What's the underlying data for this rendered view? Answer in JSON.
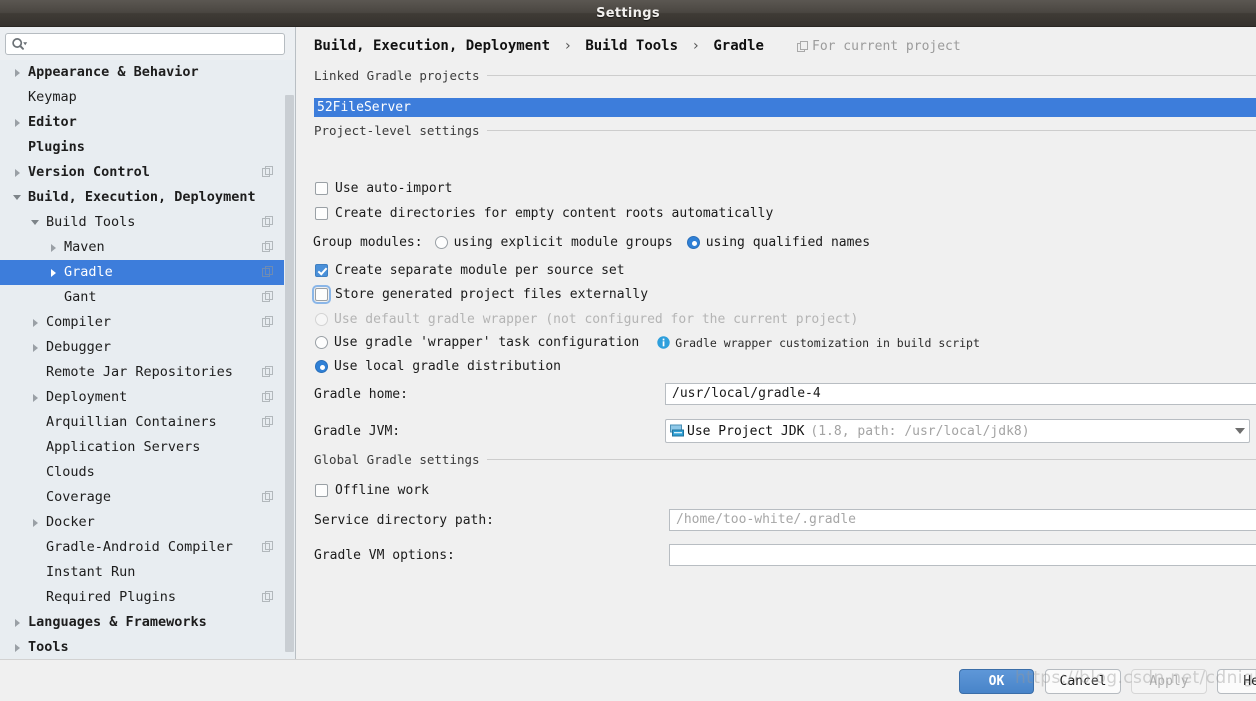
{
  "window": {
    "title": "Settings"
  },
  "search": {
    "value": "",
    "placeholder": "",
    "icon": "search-icon"
  },
  "sidebar": {
    "items": [
      {
        "label": "Appearance & Behavior",
        "indent": 0,
        "arrow": "closed",
        "bold": true,
        "badge": false,
        "selected": false
      },
      {
        "label": "Keymap",
        "indent": 0,
        "arrow": "none",
        "bold": false,
        "badge": false,
        "selected": false
      },
      {
        "label": "Editor",
        "indent": 0,
        "arrow": "closed",
        "bold": true,
        "badge": false,
        "selected": false
      },
      {
        "label": "Plugins",
        "indent": 0,
        "arrow": "none",
        "bold": true,
        "badge": false,
        "selected": false
      },
      {
        "label": "Version Control",
        "indent": 0,
        "arrow": "closed",
        "bold": true,
        "badge": true,
        "selected": false
      },
      {
        "label": "Build, Execution, Deployment",
        "indent": 0,
        "arrow": "open",
        "bold": true,
        "badge": false,
        "selected": false
      },
      {
        "label": "Build Tools",
        "indent": 1,
        "arrow": "open",
        "bold": false,
        "badge": true,
        "selected": false
      },
      {
        "label": "Maven",
        "indent": 2,
        "arrow": "closed",
        "bold": false,
        "badge": true,
        "selected": false
      },
      {
        "label": "Gradle",
        "indent": 2,
        "arrow": "closed",
        "bold": false,
        "badge": true,
        "selected": true
      },
      {
        "label": "Gant",
        "indent": 2,
        "arrow": "none",
        "bold": false,
        "badge": true,
        "selected": false
      },
      {
        "label": "Compiler",
        "indent": 1,
        "arrow": "closed",
        "bold": false,
        "badge": true,
        "selected": false
      },
      {
        "label": "Debugger",
        "indent": 1,
        "arrow": "closed",
        "bold": false,
        "badge": false,
        "selected": false
      },
      {
        "label": "Remote Jar Repositories",
        "indent": 1,
        "arrow": "none",
        "bold": false,
        "badge": true,
        "selected": false
      },
      {
        "label": "Deployment",
        "indent": 1,
        "arrow": "closed",
        "bold": false,
        "badge": true,
        "selected": false
      },
      {
        "label": "Arquillian Containers",
        "indent": 1,
        "arrow": "none",
        "bold": false,
        "badge": true,
        "selected": false
      },
      {
        "label": "Application Servers",
        "indent": 1,
        "arrow": "none",
        "bold": false,
        "badge": false,
        "selected": false
      },
      {
        "label": "Clouds",
        "indent": 1,
        "arrow": "none",
        "bold": false,
        "badge": false,
        "selected": false
      },
      {
        "label": "Coverage",
        "indent": 1,
        "arrow": "none",
        "bold": false,
        "badge": true,
        "selected": false
      },
      {
        "label": "Docker",
        "indent": 1,
        "arrow": "closed",
        "bold": false,
        "badge": false,
        "selected": false
      },
      {
        "label": "Gradle-Android Compiler",
        "indent": 1,
        "arrow": "none",
        "bold": false,
        "badge": true,
        "selected": false
      },
      {
        "label": "Instant Run",
        "indent": 1,
        "arrow": "none",
        "bold": false,
        "badge": false,
        "selected": false
      },
      {
        "label": "Required Plugins",
        "indent": 1,
        "arrow": "none",
        "bold": false,
        "badge": true,
        "selected": false
      },
      {
        "label": "Languages & Frameworks",
        "indent": 0,
        "arrow": "closed",
        "bold": true,
        "badge": false,
        "selected": false
      },
      {
        "label": "Tools",
        "indent": 0,
        "arrow": "closed",
        "bold": true,
        "badge": false,
        "selected": false
      }
    ]
  },
  "main": {
    "breadcrumb": [
      "Build, Execution, Deployment",
      "Build Tools",
      "Gradle"
    ],
    "breadcrumb_separator": "›",
    "for_current_project": "For current project",
    "groups": {
      "linked": "Linked Gradle projects",
      "project_level": "Project-level settings",
      "global": "Global Gradle settings"
    },
    "linked_project": "52FileServer",
    "options": {
      "use_auto_import": {
        "label": "Use auto-import",
        "checked": false
      },
      "create_directories": {
        "label": "Create directories for empty content roots automatically",
        "checked": false
      },
      "group_modules_label": "Group modules:",
      "group_explicit": {
        "label": "using explicit module groups",
        "checked": false
      },
      "group_qualified": {
        "label": "using qualified names",
        "checked": true
      },
      "separate_module": {
        "label": "Create separate module per source set",
        "checked": true
      },
      "store_externally": {
        "label": "Store generated project files externally",
        "checked": false,
        "focused": true
      },
      "default_wrapper": {
        "label": "Use default gradle wrapper (not configured for the current project)",
        "checked": false,
        "disabled": true
      },
      "wrapper_task": {
        "label": "Use gradle 'wrapper' task configuration",
        "checked": false
      },
      "wrapper_hint": "Gradle wrapper customization in build script",
      "local_distribution": {
        "label": "Use local gradle distribution",
        "checked": true
      },
      "offline_work": {
        "label": "Offline work",
        "checked": false
      }
    },
    "fields": {
      "gradle_home_label": "Gradle home:",
      "gradle_home_value": "/usr/local/gradle-4",
      "gradle_jvm_label": "Gradle JVM:",
      "gradle_jvm_value": "Use Project JDK",
      "gradle_jvm_detail": "(1.8, path: /usr/local/jdk8)",
      "service_dir_label": "Service directory path:",
      "service_dir_value": "/home/too-white/.gradle",
      "vm_options_label": "Gradle VM options:",
      "vm_options_value": ""
    }
  },
  "footer": {
    "ok": "OK",
    "cancel": "Cancel",
    "apply": "Apply",
    "help": "Hel"
  },
  "watermark": "https://blog.csdn.net/cdnight",
  "colors": {
    "selection": "#3d7ddb",
    "accent": "#4a90d9",
    "titlebar": "#443f3a",
    "sidebar_bg": "#e8edf1",
    "panel_bg": "#f0f0f0"
  }
}
